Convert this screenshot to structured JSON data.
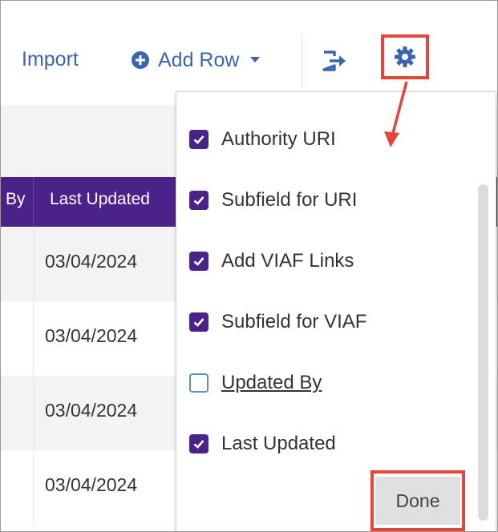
{
  "toolbar": {
    "import_label": "Import",
    "add_row_label": "Add Row",
    "accent_color": "#3a66b0",
    "highlight_color": "#e4463a",
    "icons": [
      "plus-circle-icon",
      "caret-down-icon",
      "export-icon",
      "gear-icon"
    ]
  },
  "table": {
    "header_color": "#4b2287",
    "headers": [
      "By",
      "Last Updated"
    ],
    "rows": [
      {
        "last_updated": "03/04/2024"
      },
      {
        "last_updated": "03/04/2024"
      },
      {
        "last_updated": "03/04/2024"
      },
      {
        "last_updated": "03/04/2024"
      }
    ]
  },
  "column_menu": {
    "options": [
      {
        "label": "Authority URI",
        "checked": true
      },
      {
        "label": "Subfield for URI",
        "checked": true
      },
      {
        "label": "Add VIAF Links",
        "checked": true
      },
      {
        "label": "Subfield for VIAF",
        "checked": true
      },
      {
        "label": "Updated By",
        "checked": false
      },
      {
        "label": "Last Updated",
        "checked": true
      }
    ],
    "done_label": "Done"
  }
}
